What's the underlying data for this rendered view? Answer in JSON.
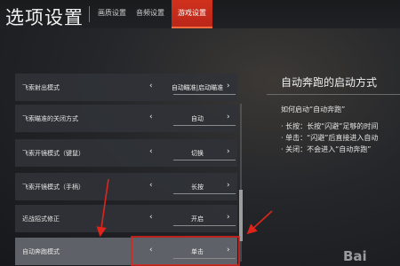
{
  "header": {
    "title": "选项设置",
    "tabs": [
      {
        "label": "画质设置"
      },
      {
        "label": "音频设置"
      },
      {
        "label": "游戏设置"
      }
    ]
  },
  "settings": [
    {
      "label": "飞索射出模式",
      "value": "自动瞄准|启动瞄准"
    },
    {
      "label": "飞索瞄准的关闭方式",
      "value": "自动"
    },
    {
      "label": "飞索开镜模式（键鼠）",
      "value": "切换"
    },
    {
      "label": "飞索开镜模式（手柄）",
      "value": "长按"
    },
    {
      "label": "近战招式修正",
      "value": "开启"
    },
    {
      "label": "自动奔跑模式",
      "value": "单击"
    }
  ],
  "help": {
    "title": "自动奔跑的启动方式",
    "question": "如何启动“自动奔跑”",
    "bullets": [
      "· 长按：长按“闪避”足够的时间",
      "· 单击：“闪避”后直接进入自动",
      "· 关闭：不会进入“自动奔跑”"
    ]
  },
  "arrows": {
    "left": "‹",
    "right": "›"
  },
  "colors": {
    "accent": "#c42d1b",
    "annotation": "#e0241c"
  },
  "watermark": "Bai"
}
